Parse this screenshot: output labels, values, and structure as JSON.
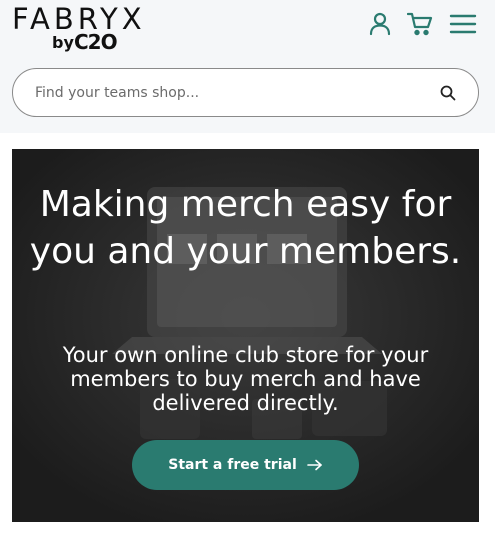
{
  "brand": {
    "name": "FABRYX",
    "by": "by",
    "c2o": "C2O"
  },
  "header": {
    "icons": {
      "account": "user-icon",
      "cart": "cart-icon",
      "menu": "hamburger-menu-icon"
    },
    "accent": "#2a7b70"
  },
  "search": {
    "placeholder": "Find your teams shop...",
    "value": "",
    "button_icon": "search-icon"
  },
  "hero": {
    "title": "Making merch easy for you and your members.",
    "subtitle": "Your own online club store for your members to buy merch and have delivered directly.",
    "cta_label": "Start a free trial",
    "cta_icon": "arrow-right-icon",
    "cta_color": "#2a7b70"
  }
}
